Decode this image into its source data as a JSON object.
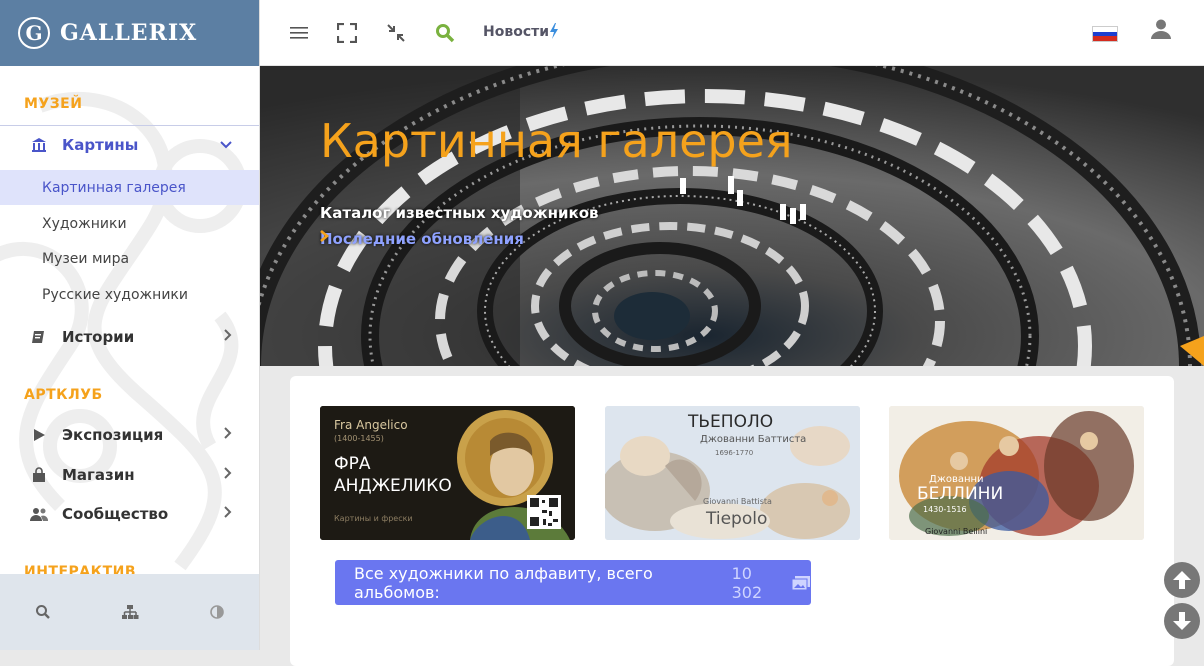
{
  "logo": {
    "letter": "G",
    "text": "GALLERIX"
  },
  "sidebar": {
    "section_museum": "МУЗЕЙ",
    "paintings": {
      "label": "Картины",
      "icon": "museum-icon"
    },
    "sub_items": [
      "Картинная галерея",
      "Художники",
      "Музеи мира",
      "Русские художники"
    ],
    "stories": {
      "label": "Истории",
      "icon": "book-icon"
    },
    "section_artclub": "АРТКЛУБ",
    "exposition": {
      "label": "Экспозиция",
      "icon": "play-icon"
    },
    "shop": {
      "label": "Магазин",
      "icon": "shopping-bag-icon"
    },
    "community": {
      "label": "Сообщество",
      "icon": "users-icon"
    },
    "section_interactive": "ИНТЕРАКТИВ",
    "footer_icons": [
      "search-icon",
      "sitemap-icon",
      "contrast-icon"
    ]
  },
  "topbar": {
    "icons": [
      "menu-icon",
      "fullscreen-icon",
      "collapse-icon",
      "search-icon"
    ],
    "news_label": "Новости",
    "language": "ru"
  },
  "hero": {
    "title": "Картинная галерея",
    "subtitle": "Каталог известных художников",
    "link": "Последние обновления"
  },
  "thumbnails": [
    {
      "top_name": "Fra Angelico",
      "dates": "(1400-1455)",
      "title_line1": "ФРА",
      "title_line2": "АНДЖЕЛИКО",
      "caption": "Картины и фрески"
    },
    {
      "title": "ТЬЕПОЛО",
      "subtitle": "Джованни Баттиста",
      "dates": "1696-1770",
      "latin_first": "Giovanni Battista",
      "latin_last": "Tiepolo"
    },
    {
      "first_name": "Джованни",
      "title": "БЕЛЛИНИ",
      "dates": "1430-1516",
      "latin": "Giovanni Bellini"
    }
  ],
  "all_artists": {
    "label": "Все художники по алфавиту, всего альбомов:",
    "count": "10 302"
  },
  "colors": {
    "accent": "#f5a21c",
    "primary": "#6a76f0",
    "logo_bar": "#5c7fa3"
  }
}
